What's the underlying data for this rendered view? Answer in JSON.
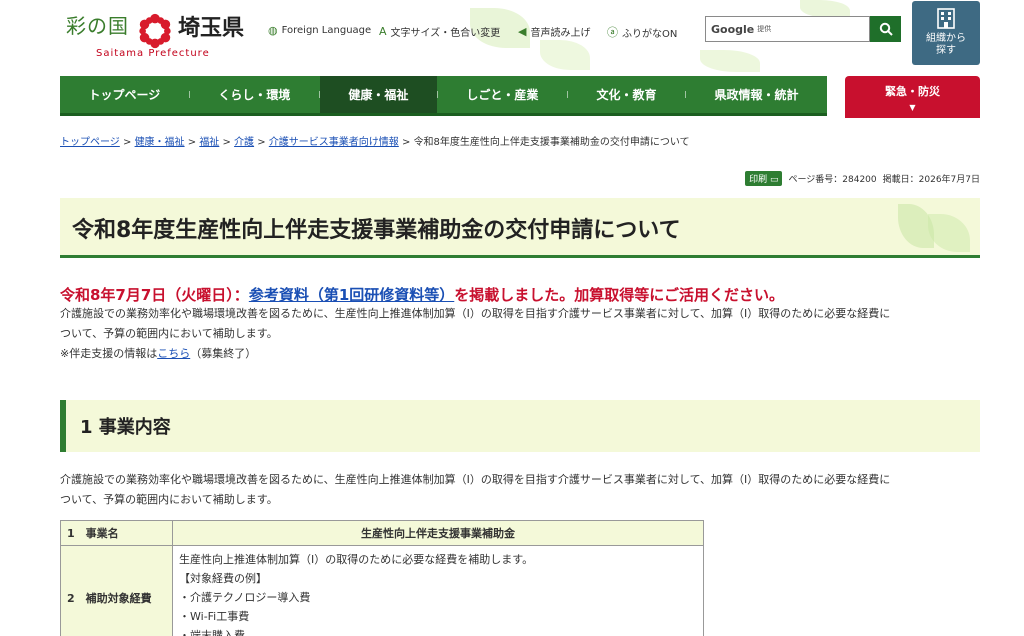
{
  "header": {
    "logo_text_1": "彩の国",
    "logo_text_2": "埼玉県",
    "logo_en": "Saitama Prefecture",
    "utilities": [
      {
        "label": "Foreign Language",
        "icon": "globe-icon"
      },
      {
        "label": "文字サイズ・色合い変更",
        "icon": "font-size-icon"
      },
      {
        "label": "音声読み上げ",
        "icon": "speaker-icon"
      },
      {
        "label": "ふりがなON",
        "icon": "furigana-icon"
      }
    ],
    "search_brand": "Google",
    "search_placeholder": "提供",
    "org_button_label": "組織から探す"
  },
  "nav": {
    "items": [
      {
        "label": "トップページ"
      },
      {
        "label": "くらし・環境"
      },
      {
        "label": "健康・福祉"
      },
      {
        "label": "しごと・産業"
      },
      {
        "label": "文化・教育"
      },
      {
        "label": "県政情報・統計"
      }
    ],
    "emergency_label": "緊急・防災",
    "emergency_arrow": "▼"
  },
  "breadcrumb": {
    "links": [
      "トップページ",
      "健康・福祉",
      "福祉",
      "介護",
      "介護サービス事業者向け情報"
    ],
    "current": "令和8年度生産性向上伴走支援事業補助金の交付申請について"
  },
  "meta": {
    "print_label": "印刷",
    "page_number": "ページ番号：284200",
    "published": "掲載日：2026年7月7日"
  },
  "page_title": "令和8年度生産性向上伴走支援事業補助金の交付申請について",
  "notice": {
    "prefix": "令和8年7月7日（火曜日）：",
    "link": "参考資料（第1回研修資料等）",
    "suffix": "を掲載しました。加算取得等にご活用ください。"
  },
  "intro": {
    "line1": "介護施設での業務効率化や職場環境改善を図るために、生産性向上推進体制加算（Ⅰ）の取得を目指す介護サービス事業者に対して、加算（Ⅰ）取得のために必要な経費に",
    "line2": "ついて、予算の範囲内において補助します。",
    "note_prefix": "※伴走支援の情報は",
    "note_link": "こちら",
    "note_suffix": "（募集終了）"
  },
  "section1": {
    "heading": "1 事業内容",
    "line1": "介護施設での業務効率化や職場環境改善を図るために、生産性向上推進体制加算（Ⅰ）の取得を目指す介護サービス事業者に対して、加算（Ⅰ）取得のために必要な経費に",
    "line2": "ついて、予算の範囲内において補助します。"
  },
  "table": {
    "row1_head": "1　事業名",
    "row1_value": "生産性向上伴走支援事業補助金",
    "row2_head": "2　補助対象経費",
    "row2_lines": [
      "生産性向上推進体制加算（Ⅰ）の取得のために必要な経費を補助します。",
      "【対象経費の例】",
      "・介護テクノロジー導入費",
      "・Wi-Fi工事費",
      "・端末購入費"
    ]
  }
}
